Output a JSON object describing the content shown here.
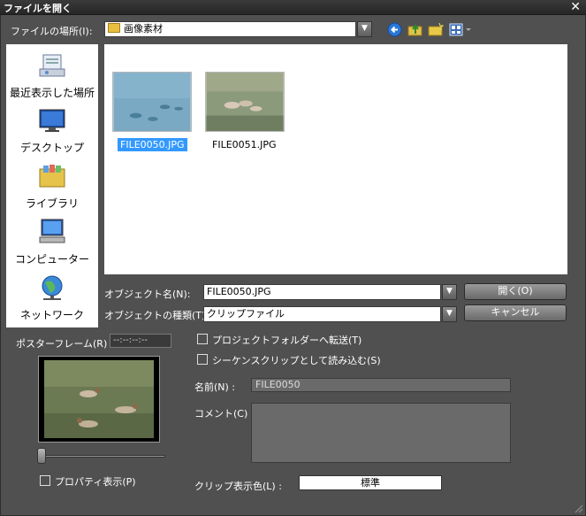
{
  "window": {
    "title": "ファイルを開く",
    "close": "✕"
  },
  "location": {
    "label": "ファイルの場所(I):",
    "value": "画像素材"
  },
  "places": [
    {
      "label": "最近表示した場所",
      "icon": "recent-places-icon"
    },
    {
      "label": "デスクトップ",
      "icon": "desktop-icon"
    },
    {
      "label": "ライブラリ",
      "icon": "library-icon"
    },
    {
      "label": "コンピューター",
      "icon": "computer-icon"
    },
    {
      "label": "ネットワーク",
      "icon": "network-icon"
    }
  ],
  "files": [
    {
      "name": "FILE0050.JPG",
      "selected": true
    },
    {
      "name": "FILE0051.JPG",
      "selected": false
    }
  ],
  "object_name": {
    "label": "オブジェクト名(N):",
    "value": "FILE0050.JPG"
  },
  "object_type": {
    "label": "オブジェクトの種類(T):",
    "value": "クリップファイル"
  },
  "buttons": {
    "open": "開く(O)",
    "cancel": "キャンセル"
  },
  "poster_frame": {
    "label": "ポスターフレーム(R) :",
    "value": "--:--:--:--"
  },
  "options": {
    "transfer": "プロジェクトフォルダーへ転送(T)",
    "sequence": "シーケンスクリップとして読み込む(S)",
    "property": "プロパティ表示(P)"
  },
  "details": {
    "name_label": "名前(N) :",
    "name_value": "FILE0050",
    "comment_label": "コメント(C) :",
    "clip_color_label": "クリップ表示色(L) :",
    "clip_color_value": "標準"
  },
  "colors": {
    "selection": "#3399ff",
    "background": "#505050"
  }
}
